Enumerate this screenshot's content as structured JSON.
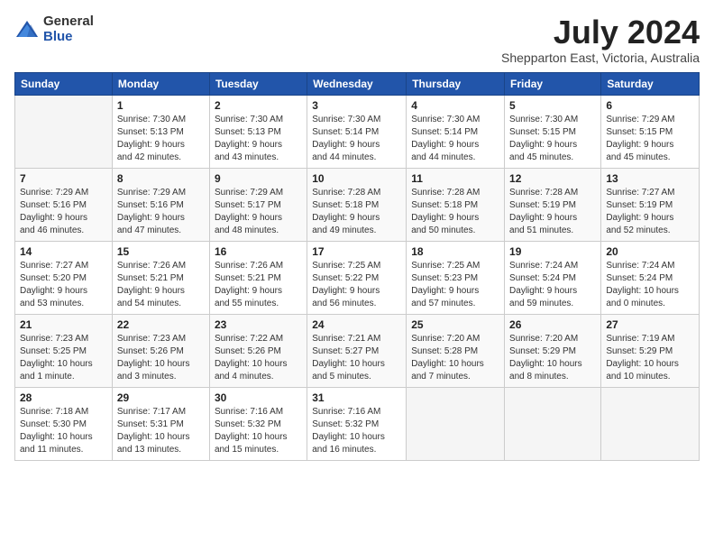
{
  "header": {
    "logo_general": "General",
    "logo_blue": "Blue",
    "month_title": "July 2024",
    "location": "Shepparton East, Victoria, Australia"
  },
  "days_of_week": [
    "Sunday",
    "Monday",
    "Tuesday",
    "Wednesday",
    "Thursday",
    "Friday",
    "Saturday"
  ],
  "weeks": [
    [
      {
        "num": "",
        "info": ""
      },
      {
        "num": "1",
        "info": "Sunrise: 7:30 AM\nSunset: 5:13 PM\nDaylight: 9 hours\nand 42 minutes."
      },
      {
        "num": "2",
        "info": "Sunrise: 7:30 AM\nSunset: 5:13 PM\nDaylight: 9 hours\nand 43 minutes."
      },
      {
        "num": "3",
        "info": "Sunrise: 7:30 AM\nSunset: 5:14 PM\nDaylight: 9 hours\nand 44 minutes."
      },
      {
        "num": "4",
        "info": "Sunrise: 7:30 AM\nSunset: 5:14 PM\nDaylight: 9 hours\nand 44 minutes."
      },
      {
        "num": "5",
        "info": "Sunrise: 7:30 AM\nSunset: 5:15 PM\nDaylight: 9 hours\nand 45 minutes."
      },
      {
        "num": "6",
        "info": "Sunrise: 7:29 AM\nSunset: 5:15 PM\nDaylight: 9 hours\nand 45 minutes."
      }
    ],
    [
      {
        "num": "7",
        "info": "Sunrise: 7:29 AM\nSunset: 5:16 PM\nDaylight: 9 hours\nand 46 minutes."
      },
      {
        "num": "8",
        "info": "Sunrise: 7:29 AM\nSunset: 5:16 PM\nDaylight: 9 hours\nand 47 minutes."
      },
      {
        "num": "9",
        "info": "Sunrise: 7:29 AM\nSunset: 5:17 PM\nDaylight: 9 hours\nand 48 minutes."
      },
      {
        "num": "10",
        "info": "Sunrise: 7:28 AM\nSunset: 5:18 PM\nDaylight: 9 hours\nand 49 minutes."
      },
      {
        "num": "11",
        "info": "Sunrise: 7:28 AM\nSunset: 5:18 PM\nDaylight: 9 hours\nand 50 minutes."
      },
      {
        "num": "12",
        "info": "Sunrise: 7:28 AM\nSunset: 5:19 PM\nDaylight: 9 hours\nand 51 minutes."
      },
      {
        "num": "13",
        "info": "Sunrise: 7:27 AM\nSunset: 5:19 PM\nDaylight: 9 hours\nand 52 minutes."
      }
    ],
    [
      {
        "num": "14",
        "info": "Sunrise: 7:27 AM\nSunset: 5:20 PM\nDaylight: 9 hours\nand 53 minutes."
      },
      {
        "num": "15",
        "info": "Sunrise: 7:26 AM\nSunset: 5:21 PM\nDaylight: 9 hours\nand 54 minutes."
      },
      {
        "num": "16",
        "info": "Sunrise: 7:26 AM\nSunset: 5:21 PM\nDaylight: 9 hours\nand 55 minutes."
      },
      {
        "num": "17",
        "info": "Sunrise: 7:25 AM\nSunset: 5:22 PM\nDaylight: 9 hours\nand 56 minutes."
      },
      {
        "num": "18",
        "info": "Sunrise: 7:25 AM\nSunset: 5:23 PM\nDaylight: 9 hours\nand 57 minutes."
      },
      {
        "num": "19",
        "info": "Sunrise: 7:24 AM\nSunset: 5:24 PM\nDaylight: 9 hours\nand 59 minutes."
      },
      {
        "num": "20",
        "info": "Sunrise: 7:24 AM\nSunset: 5:24 PM\nDaylight: 10 hours\nand 0 minutes."
      }
    ],
    [
      {
        "num": "21",
        "info": "Sunrise: 7:23 AM\nSunset: 5:25 PM\nDaylight: 10 hours\nand 1 minute."
      },
      {
        "num": "22",
        "info": "Sunrise: 7:23 AM\nSunset: 5:26 PM\nDaylight: 10 hours\nand 3 minutes."
      },
      {
        "num": "23",
        "info": "Sunrise: 7:22 AM\nSunset: 5:26 PM\nDaylight: 10 hours\nand 4 minutes."
      },
      {
        "num": "24",
        "info": "Sunrise: 7:21 AM\nSunset: 5:27 PM\nDaylight: 10 hours\nand 5 minutes."
      },
      {
        "num": "25",
        "info": "Sunrise: 7:20 AM\nSunset: 5:28 PM\nDaylight: 10 hours\nand 7 minutes."
      },
      {
        "num": "26",
        "info": "Sunrise: 7:20 AM\nSunset: 5:29 PM\nDaylight: 10 hours\nand 8 minutes."
      },
      {
        "num": "27",
        "info": "Sunrise: 7:19 AM\nSunset: 5:29 PM\nDaylight: 10 hours\nand 10 minutes."
      }
    ],
    [
      {
        "num": "28",
        "info": "Sunrise: 7:18 AM\nSunset: 5:30 PM\nDaylight: 10 hours\nand 11 minutes."
      },
      {
        "num": "29",
        "info": "Sunrise: 7:17 AM\nSunset: 5:31 PM\nDaylight: 10 hours\nand 13 minutes."
      },
      {
        "num": "30",
        "info": "Sunrise: 7:16 AM\nSunset: 5:32 PM\nDaylight: 10 hours\nand 15 minutes."
      },
      {
        "num": "31",
        "info": "Sunrise: 7:16 AM\nSunset: 5:32 PM\nDaylight: 10 hours\nand 16 minutes."
      },
      {
        "num": "",
        "info": ""
      },
      {
        "num": "",
        "info": ""
      },
      {
        "num": "",
        "info": ""
      }
    ]
  ]
}
